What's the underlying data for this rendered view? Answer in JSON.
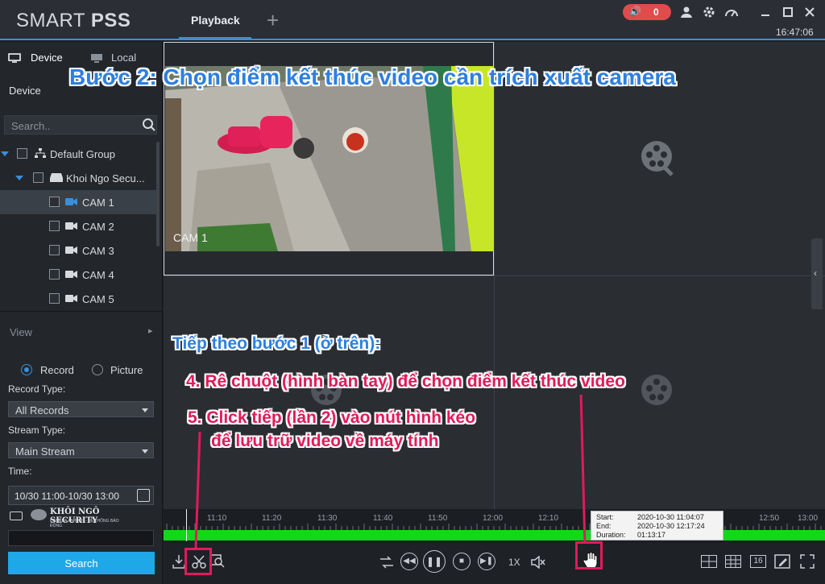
{
  "app": {
    "logo_light": "SMART ",
    "logo_bold": "PSS",
    "clock": "16:47:06"
  },
  "tabs": {
    "active": "Playback",
    "add": "+"
  },
  "alarm": {
    "count": "0"
  },
  "titlebar_icons": [
    "user-icon",
    "gear-icon",
    "gauge-icon",
    "minimize-icon",
    "maximize-icon",
    "close-icon"
  ],
  "sidebar": {
    "tab_device": "Device",
    "tab_local": "Local",
    "device_label": "Device",
    "search_placeholder": "Search..",
    "tree": [
      {
        "label": "Default Group"
      },
      {
        "label": "Khoi Ngo Secu..."
      },
      {
        "label": "CAM 1"
      },
      {
        "label": "CAM 2"
      },
      {
        "label": "CAM 3"
      },
      {
        "label": "CAM 4"
      },
      {
        "label": "CAM 5"
      }
    ],
    "view_label": "View",
    "radio_record": "Record",
    "radio_picture": "Picture",
    "record_type_label": "Record Type:",
    "record_type_value": "All Records",
    "stream_type_label": "Stream Type:",
    "stream_type_value": "Main Stream",
    "time_label": "Time:",
    "time_value": "10/30 11:00-10/30 13:00",
    "brand_name": "KHÔI NGÔ SECURITY",
    "brand_tagline": "CAMERA AN NINH - HỆ THỐNG BÁO ĐỘNG",
    "search_button": "Search"
  },
  "video": {
    "cam_label": "CAM 1"
  },
  "timeline": {
    "labels": [
      "11:10",
      "11:20",
      "11:30",
      "11:40",
      "11:50",
      "12:00",
      "12:10",
      "12:50",
      "13:00"
    ],
    "tooltip": {
      "start_label": "Start:",
      "start_value": "2020-10-30 11:04:07",
      "end_label": "End:",
      "end_value": "2020-10-30 12:17:24",
      "duration_label": "Duration:",
      "duration_value": "01:13:17"
    }
  },
  "controls": {
    "speed": "1X",
    "split_16": "16"
  },
  "overlay": {
    "title": "Bước 2: Chọn điểm kết thúc video cần trích xuất camera",
    "subtitle": "Tiếp theo bước 1 (ở trên):",
    "step4": "4. Rê chuột (hình bàn tay) để chọn điểm kết thúc video",
    "step5a": "5. Click tiếp (lần 2) vào nút hình kéo",
    "step5b": "để lưu trữ video về máy tính"
  },
  "colors": {
    "accent": "#3a8fd8",
    "highlight": "#e01b5a",
    "record_bar": "#12d81a",
    "search_button": "#1fa8e8"
  }
}
